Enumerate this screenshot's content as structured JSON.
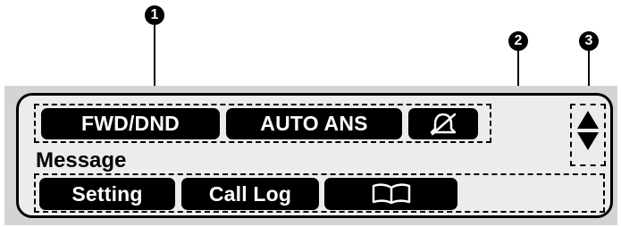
{
  "callouts": {
    "c1": "1",
    "c2": "2",
    "c3": "3"
  },
  "top_softkeys": {
    "fwd_dnd": "FWD/DND",
    "auto_ans": "AUTO ANS",
    "ringer_off_icon": "bell-slash-icon"
  },
  "message_label": "Message",
  "bottom_softkeys": {
    "setting": "Setting",
    "call_log": "Call Log",
    "phonebook_icon": "open-book-icon"
  },
  "navigator_icon": "up-down-arrows-icon"
}
